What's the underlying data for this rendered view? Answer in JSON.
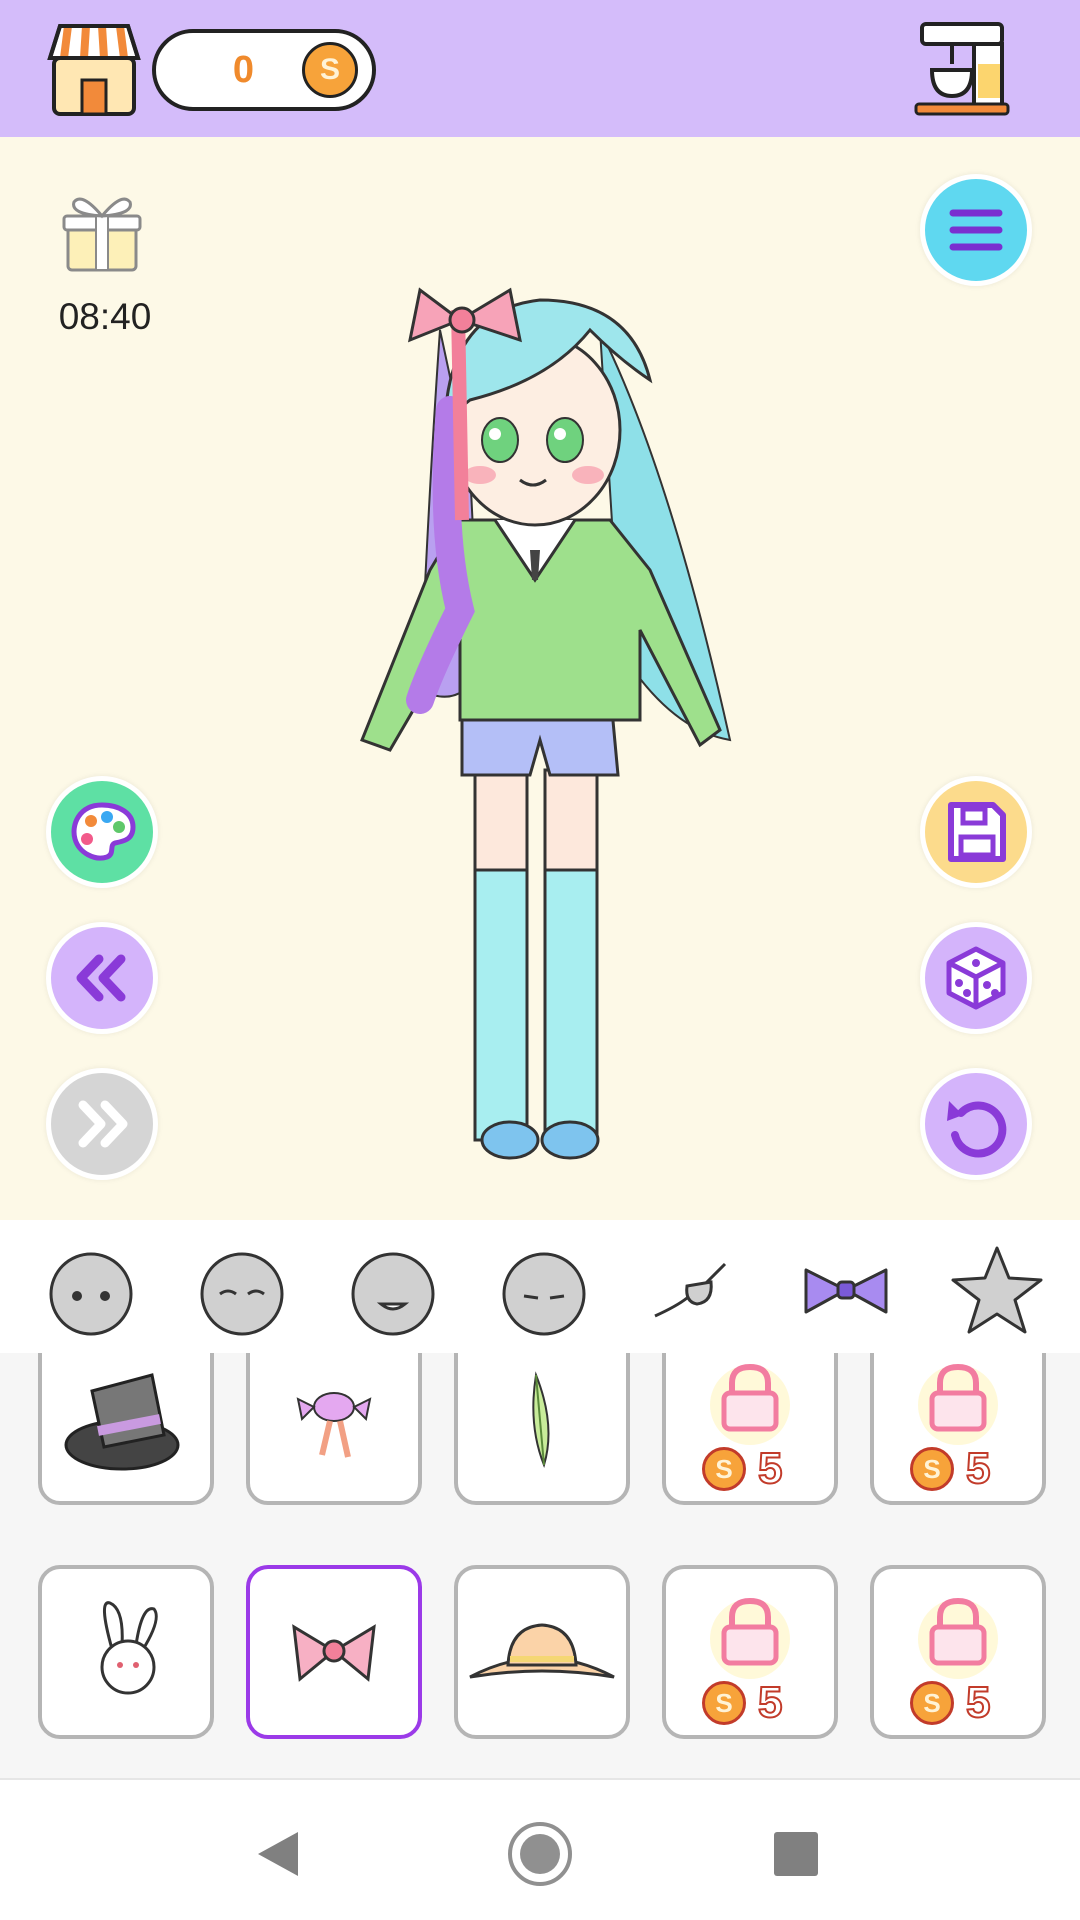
{
  "header": {
    "coin_count": "0",
    "coin_symbol": "S"
  },
  "gift": {
    "timer": "08:40"
  },
  "colors": {
    "header_bg": "#d4bcfa",
    "stage_bg": "#fdf9e7",
    "accent_purple": "#9b3ae8",
    "menu_button": "#5fd8f0",
    "palette_button": "#5ee0a4",
    "save_button": "#fcdb8c",
    "round_button": "#d4b4fb",
    "disabled_button": "#d5d5d5"
  },
  "left_buttons": [
    {
      "icon": "palette-icon"
    },
    {
      "icon": "double-chevron-left-icon"
    },
    {
      "icon": "double-chevron-right-icon",
      "disabled": true
    }
  ],
  "right_buttons": [
    {
      "icon": "menu-icon"
    },
    {
      "icon": "save-icon"
    },
    {
      "icon": "dice-icon"
    },
    {
      "icon": "undo-icon"
    }
  ],
  "category_tabs": [
    {
      "icon": "face-neutral-icon"
    },
    {
      "icon": "face-closed-eyes-icon"
    },
    {
      "icon": "face-smile-icon"
    },
    {
      "icon": "face-sleepy-icon"
    },
    {
      "icon": "eyepatch-icon"
    },
    {
      "icon": "bow-icon",
      "selected": true
    },
    {
      "icon": "star-icon"
    }
  ],
  "items": [
    {
      "icon": "top-hat-icon",
      "locked": false
    },
    {
      "icon": "candy-ribbon-icon",
      "locked": false
    },
    {
      "icon": "feather-icon",
      "locked": false
    },
    {
      "icon": "lock-icon",
      "locked": true,
      "price": "5",
      "currency": "S"
    },
    {
      "icon": "lock-icon",
      "locked": true,
      "price": "5",
      "currency": "S"
    },
    {
      "icon": "bunny-icon",
      "locked": false
    },
    {
      "icon": "pink-bow-icon",
      "locked": false,
      "selected": true
    },
    {
      "icon": "sun-hat-icon",
      "locked": false
    },
    {
      "icon": "lock-icon",
      "locked": true,
      "price": "5",
      "currency": "S"
    },
    {
      "icon": "lock-icon",
      "locked": true,
      "price": "5",
      "currency": "S"
    }
  ],
  "system_nav": [
    {
      "icon": "back-icon"
    },
    {
      "icon": "home-icon"
    },
    {
      "icon": "recents-icon"
    }
  ]
}
